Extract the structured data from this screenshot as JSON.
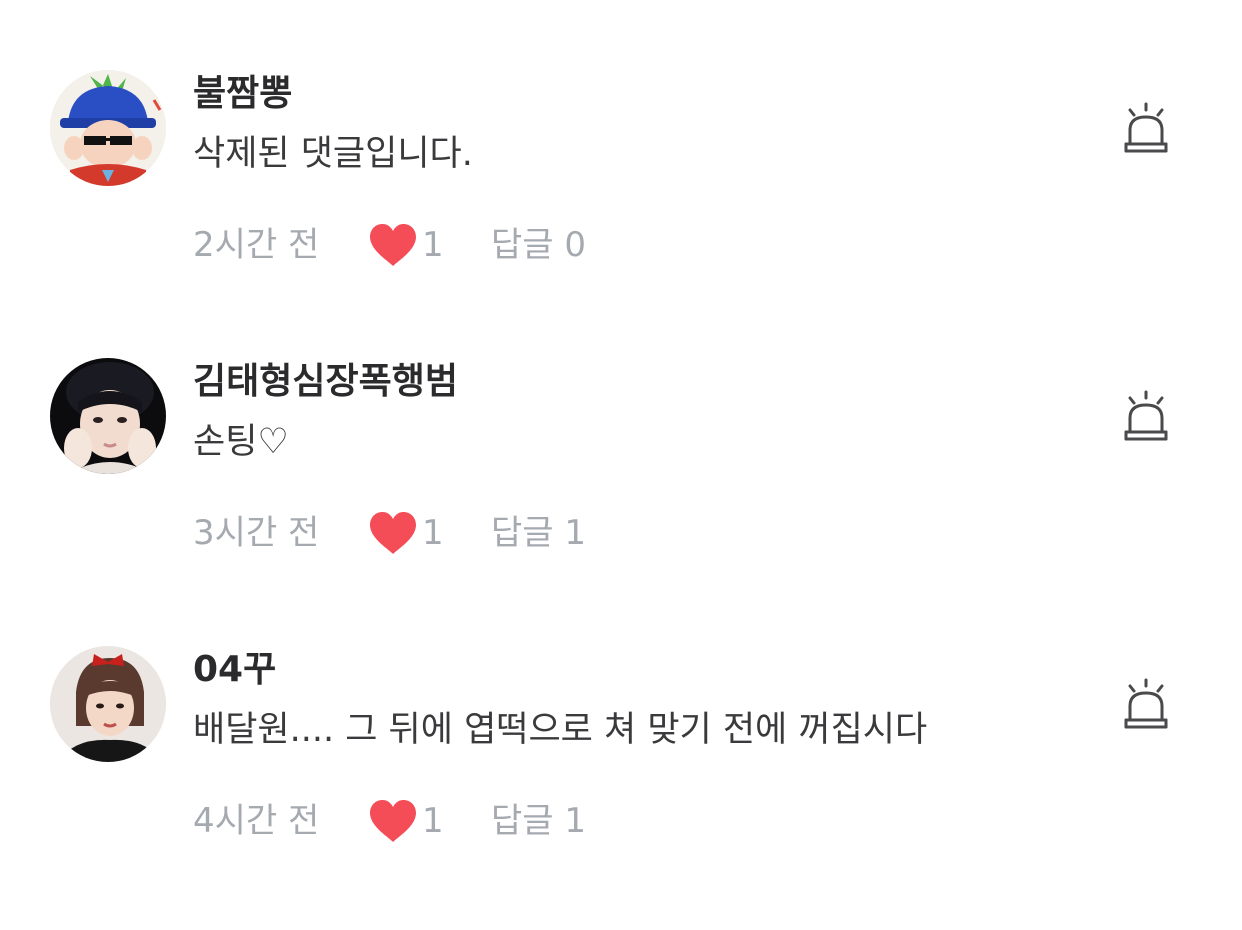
{
  "colors": {
    "username": "#2b2b2d",
    "body": "#3a3a3c",
    "meta": "#a5a9b0",
    "heart": "#f44d57",
    "icon": "#4a4a4c"
  },
  "icons": {
    "like": "heart-icon",
    "report": "siren-icon"
  },
  "comments": [
    {
      "username": "불짬뽕",
      "text": "삭제된 댓글입니다.",
      "time": "2시간 전",
      "likes": "1",
      "reply_label": "답글",
      "replies": "0"
    },
    {
      "username": "김태형심장폭행범",
      "text": "손팅♡",
      "time": "3시간 전",
      "likes": "1",
      "reply_label": "답글",
      "replies": "1"
    },
    {
      "username": "04꾸",
      "text": "배달원.... 그 뒤에 엽떡으로 쳐 맞기 전에 꺼집시다",
      "time": "4시간 전",
      "likes": "1",
      "reply_label": "답글",
      "replies": "1"
    }
  ]
}
